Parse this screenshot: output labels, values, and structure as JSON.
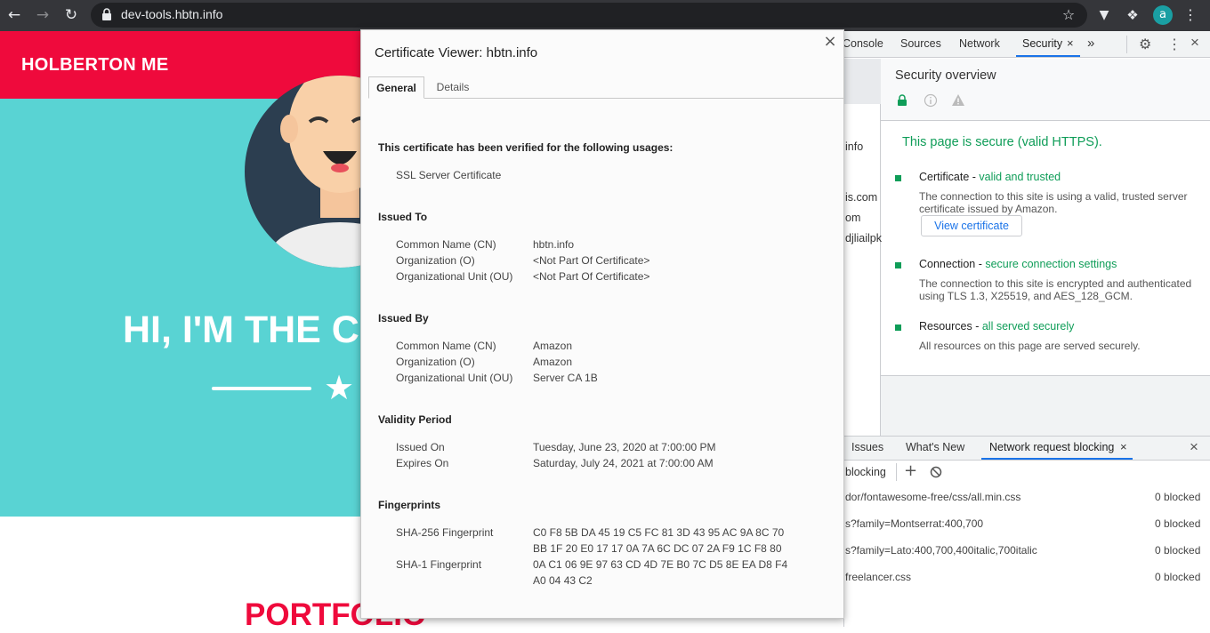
{
  "browser": {
    "url": "dev-tools.hbtn.info",
    "profile_initial": "a",
    "icons": {
      "back": "back-arrow-icon",
      "forward": "forward-arrow-icon",
      "reload": "reload-icon",
      "lock": "lock-icon",
      "star": "bookmark-star-icon",
      "extension": "extension-icon",
      "puzzle": "puzzle-icon",
      "menu": "kebab-menu-icon"
    }
  },
  "site": {
    "brand": "HOLBERTON ME",
    "hero_title": "HI, I'M THE C",
    "portfolio_heading": "PORTFOLIO"
  },
  "devtools": {
    "tabs": [
      "Console",
      "Sources",
      "Network",
      "Security"
    ],
    "more_tabs": "»",
    "origins": [
      "info",
      "is.com",
      "om",
      "djliailpk"
    ],
    "security": {
      "title": "Security overview",
      "secure_message": "This page is secure (valid HTTPS).",
      "certificate": {
        "label": "Certificate - ",
        "status": "valid and trusted",
        "body": "The connection to this site is using a valid, trusted server certificate issued by Amazon.",
        "button": "View certificate"
      },
      "connection": {
        "label": "Connection - ",
        "status": "secure connection settings",
        "body": "The connection to this site is encrypted and authenticated using TLS 1.3, X25519, and AES_128_GCM."
      },
      "resources": {
        "label": "Resources - ",
        "status": "all served securely",
        "body": "All resources on this page are served securely."
      }
    },
    "drawer": {
      "tabs": [
        "Issues",
        "What's New",
        "Network request blocking"
      ],
      "toolbar_label": "blocking",
      "rows": [
        {
          "pattern": "dor/fontawesome-free/css/all.min.css",
          "count": "0 blocked"
        },
        {
          "pattern": "s?family=Montserrat:400,700",
          "count": "0 blocked"
        },
        {
          "pattern": "s?family=Lato:400,700,400italic,700italic",
          "count": "0 blocked"
        },
        {
          "pattern": "freelancer.css",
          "count": "0 blocked"
        }
      ]
    }
  },
  "certificate_viewer": {
    "title": "Certificate Viewer: hbtn.info",
    "tabs": {
      "general": "General",
      "details": "Details"
    },
    "usages_heading": "This certificate has been verified for the following usages:",
    "usages": [
      "SSL Server Certificate"
    ],
    "issued_to": {
      "heading": "Issued To",
      "rows": [
        {
          "label": "Common Name (CN)",
          "value": "hbtn.info"
        },
        {
          "label": "Organization (O)",
          "value": "<Not Part Of Certificate>"
        },
        {
          "label": "Organizational Unit (OU)",
          "value": "<Not Part Of Certificate>"
        }
      ]
    },
    "issued_by": {
      "heading": "Issued By",
      "rows": [
        {
          "label": "Common Name (CN)",
          "value": "Amazon"
        },
        {
          "label": "Organization (O)",
          "value": "Amazon"
        },
        {
          "label": "Organizational Unit (OU)",
          "value": "Server CA 1B"
        }
      ]
    },
    "validity": {
      "heading": "Validity Period",
      "rows": [
        {
          "label": "Issued On",
          "value": "Tuesday, June 23, 2020 at 7:00:00 PM"
        },
        {
          "label": "Expires On",
          "value": "Saturday, July 24, 2021 at 7:00:00 AM"
        }
      ]
    },
    "fingerprints": {
      "heading": "Fingerprints",
      "sha256_label": "SHA-256 Fingerprint",
      "sha256_line1": "C0 F8 5B DA 45 19 C5 FC 81 3D 43 95 AC 9A 8C 70",
      "sha256_line2": "BB 1F 20 E0 17 17 0A 7A 6C DC 07 2A F9 1C F8 80",
      "sha1_label": "SHA-1 Fingerprint",
      "sha1_line1": "0A C1 06 9E 97 63 CD 4D 7E B0 7C D5 8E EA D8 F4",
      "sha1_line2": "A0 04 43 C2"
    }
  },
  "colors": {
    "brand_red": "#ef0a3c",
    "hero_teal": "#59d3d3",
    "secure_green": "#0f9d58",
    "link_blue": "#1a73e8"
  }
}
